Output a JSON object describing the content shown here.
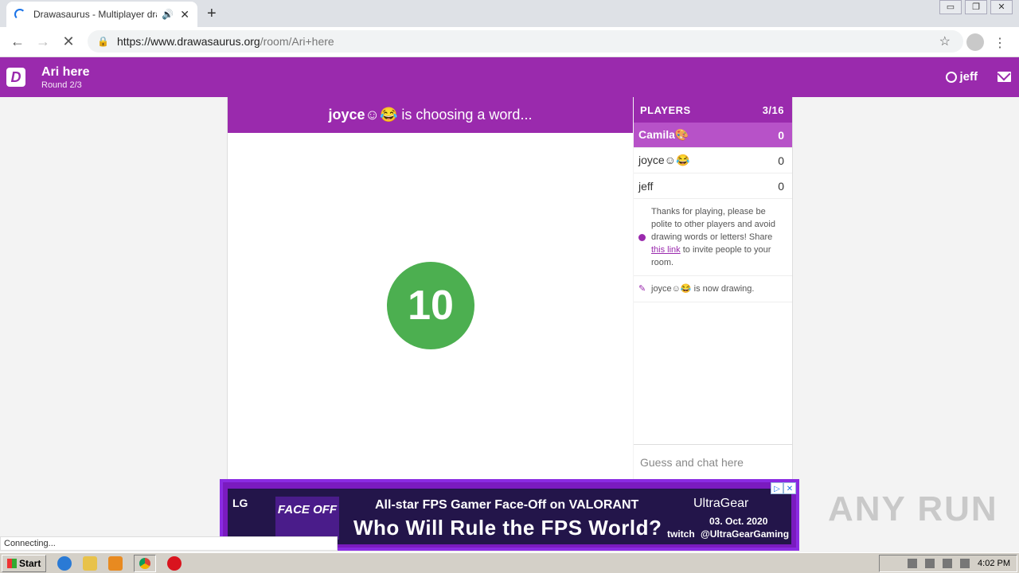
{
  "browser": {
    "tab_title": "Drawasaurus - Multiplayer draw",
    "tab_audio_icon": "speaker-icon",
    "tab_close": "✕",
    "new_tab": "+",
    "url_host": "https://www.drawasaurus.org",
    "url_path": "/room/Ari+here",
    "status_text": "Connecting..."
  },
  "header": {
    "logo_letter": "D",
    "room_name": "Ari here",
    "round": "Round 2/3",
    "username": "jeff"
  },
  "game": {
    "chooser": "joyce☺😂",
    "status_suffix": " is choosing a word...",
    "timer": "10"
  },
  "players": {
    "heading": "PLAYERS",
    "count": "3/16",
    "list": [
      {
        "name": "Camila🎨",
        "score": "0"
      },
      {
        "name": "joyce☺😂",
        "score": "0"
      },
      {
        "name": "jeff",
        "score": "0"
      }
    ]
  },
  "chat": {
    "notice_before": "Thanks for playing, please be polite to other players and avoid drawing words or letters! Share ",
    "notice_link": "this link",
    "notice_after": " to invite people to your room.",
    "drawing_msg": "joyce☺😂 is now drawing.",
    "input_placeholder": "Guess and chat here"
  },
  "ad": {
    "lg": "LG",
    "faceoff": "FACE OFF",
    "line1": "All-star FPS Gamer Face-Off on VALORANT",
    "line2": "Who Will Rule the FPS World?",
    "brand": "UltraGear",
    "date": "03. Oct. 2020",
    "twitch": "twitch",
    "handle": "@UltraGearGaming"
  },
  "watermark": "ANY RUN",
  "taskbar": {
    "start": "Start",
    "clock": "4:02 PM"
  }
}
